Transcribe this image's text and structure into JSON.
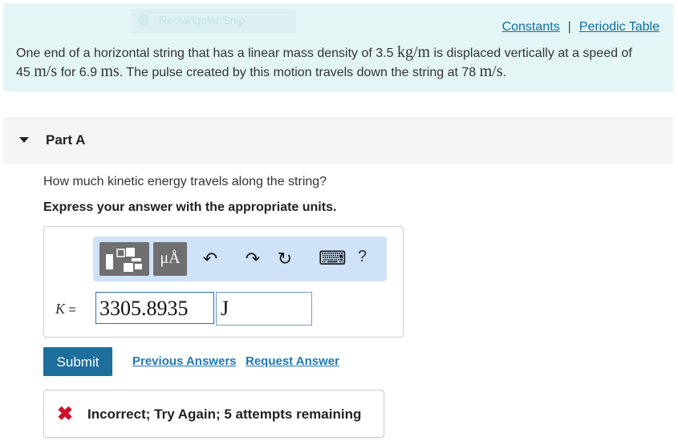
{
  "overlay": {
    "snip_label": "Rectangular Snip"
  },
  "header": {
    "constants_label": "Constants",
    "separator": "|",
    "periodic_table_label": "Periodic Table"
  },
  "problem": {
    "t1": "One end of a horizontal string that has a linear mass density of 3.5",
    "unit_kg_m": "kg/m",
    "t2": "is displaced vertically at a speed of",
    "t3": "45",
    "unit_m_s_1": "m/s",
    "t4": "for 6.9",
    "unit_ms": "ms",
    "t5": ". The pulse created by this motion travels down the string at 78",
    "unit_m_s_2": "m/s",
    "t6": "."
  },
  "part": {
    "title": "Part A",
    "question": "How much kinetic energy travels along the string?",
    "instruction": "Express your answer with the appropriate units."
  },
  "toolbar": {
    "units_label": "μÅ",
    "undo_glyph": "↶",
    "redo_glyph": "↷",
    "reset_glyph": "↻",
    "keyboard_glyph": "⌨",
    "help_label": "?",
    "icons": [
      "templates-icon",
      "units-icon",
      "undo-icon",
      "redo-icon",
      "reset-icon",
      "keyboard-icon",
      "help-icon"
    ]
  },
  "answer": {
    "variable": "K",
    "equals": "=",
    "value": "3305.8935",
    "unit": "J"
  },
  "actions": {
    "submit_label": "Submit",
    "previous_answers_label": "Previous Answers",
    "request_answer_label": "Request Answer"
  },
  "feedback": {
    "icon": "✖",
    "message": "Incorrect; Try Again; 5 attempts remaining"
  },
  "colors": {
    "problem_bg": "#e4f5f5",
    "link": "#0a6fa8",
    "submit_bg": "#1e6f9c",
    "toolbar_bg": "#cfe2f8",
    "error": "#d0102b"
  }
}
